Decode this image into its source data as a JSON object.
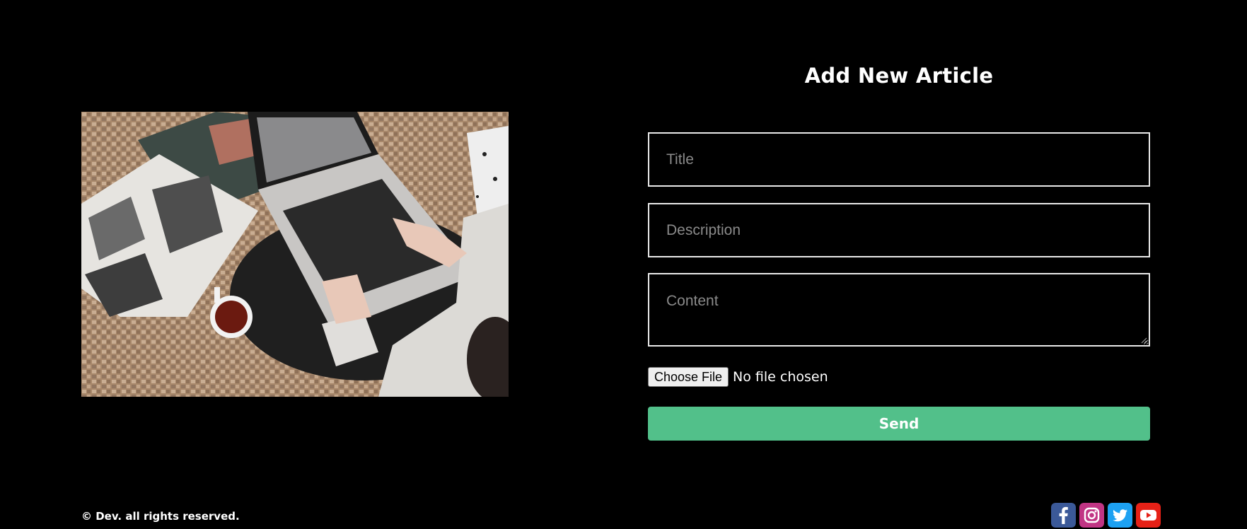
{
  "form": {
    "heading": "Add New Article",
    "title_placeholder": "Title",
    "description_placeholder": "Description",
    "content_placeholder": "Content",
    "file_button_label": "Choose File",
    "file_status": "No file chosen",
    "send_label": "Send"
  },
  "hero_image": {
    "icon": "laptop-reading-photo"
  },
  "footer": {
    "copyright": "© Dev. all rights reserved.",
    "social": [
      {
        "icon": "facebook-icon",
        "color": "#3b5998"
      },
      {
        "icon": "instagram-icon",
        "color": "#c13584"
      },
      {
        "icon": "twitter-icon",
        "color": "#1da1f2"
      },
      {
        "icon": "youtube-icon",
        "color": "#e62117"
      }
    ]
  },
  "colors": {
    "background": "#000000",
    "accent": "#52c08a",
    "field_border": "#e9e9e9"
  }
}
